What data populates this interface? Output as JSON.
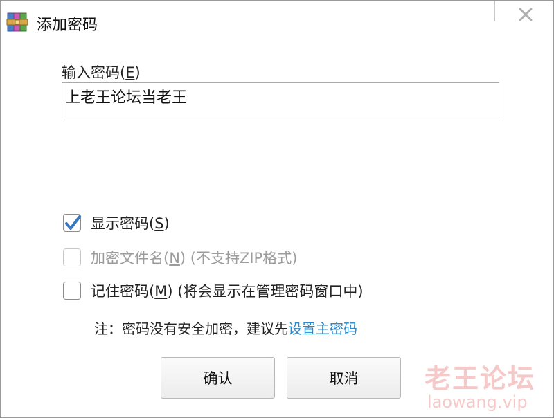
{
  "window": {
    "title": "添加密码",
    "app_icon": "winrar-archive-icon",
    "close_icon": "close-icon"
  },
  "password": {
    "label_prefix": "输入密码(",
    "label_hotkey": "E",
    "label_suffix": ")",
    "value": "上老王论坛当老王",
    "placeholder": ""
  },
  "options": {
    "show_password": {
      "prefix": "显示密码(",
      "hotkey": "S",
      "suffix": ")",
      "checked": true
    },
    "encrypt_filenames": {
      "prefix": "加密文件名(",
      "hotkey": "N",
      "suffix": ") (不支持ZIP格式)",
      "checked": false,
      "enabled": false
    },
    "remember_password": {
      "prefix": "记住密码(",
      "hotkey": "M",
      "suffix": ") (将会显示在管理密码窗口中)",
      "checked": false
    }
  },
  "note": {
    "text": "注：密码没有安全加密，建议先",
    "link": "设置主密码"
  },
  "buttons": {
    "ok": "确认",
    "cancel": "取消"
  },
  "watermark": {
    "cn": "老王论坛",
    "en": "laowang.vip"
  },
  "colors": {
    "link": "#2b87c8",
    "check": "#3b78c4",
    "disabled_text": "#9c9c9c",
    "watermark": "#e46464"
  }
}
